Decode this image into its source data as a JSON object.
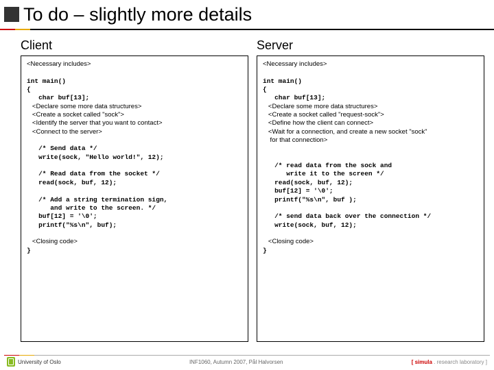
{
  "title": "To do – slightly more details",
  "client": {
    "heading": "Client",
    "pre": "<Necessary includes>\n\n",
    "main1": "int main()\n{\n   char buf[13];\n",
    "decl": "   <Declare some more data structures>\n   <Create a socket called \"sock\">\n   <Identify the server that you want to contact>\n   <Connect to the server>\n\n",
    "body": "   /* Send data */\n   write(sock, \"Hello world!\", 12);\n\n   /* Read data from the socket */\n   read(sock, buf, 12);\n\n   /* Add a string termination sign,\n      and write to the screen. */\n   buf[12] = '\\0';\n   printf(\"%s\\n\", buf);\n\n",
    "close": "   <Closing code>\n",
    "end": "}"
  },
  "server": {
    "heading": "Server",
    "pre": "<Necessary includes>\n\n",
    "main1": "int main()\n{\n   char buf[13];\n",
    "decl": "   <Declare some more data structures>\n   <Create a socket called \"request-sock\">\n   <Define how the client can connect>\n   <Wait for a connection, and create a new socket \"sock\"\n    for that connection>\n\n",
    "body": "\n   /* read data from the sock and\n      write it to the screen */\n   read(sock, buf, 12);\n   buf[12] = '\\0';\n   printf(\"%s\\n\", buf );\n\n   /* send data back over the connection */\n   write(sock, buf, 12);\n\n",
    "close": "   <Closing code>\n",
    "end": "}"
  },
  "footer": {
    "uni": "University of Oslo",
    "center": "INF1060, Autumn 2007, Pål Halvorsen",
    "sim_open": "[ ",
    "sim": "simula",
    "sim_rest": " . research laboratory ]"
  }
}
